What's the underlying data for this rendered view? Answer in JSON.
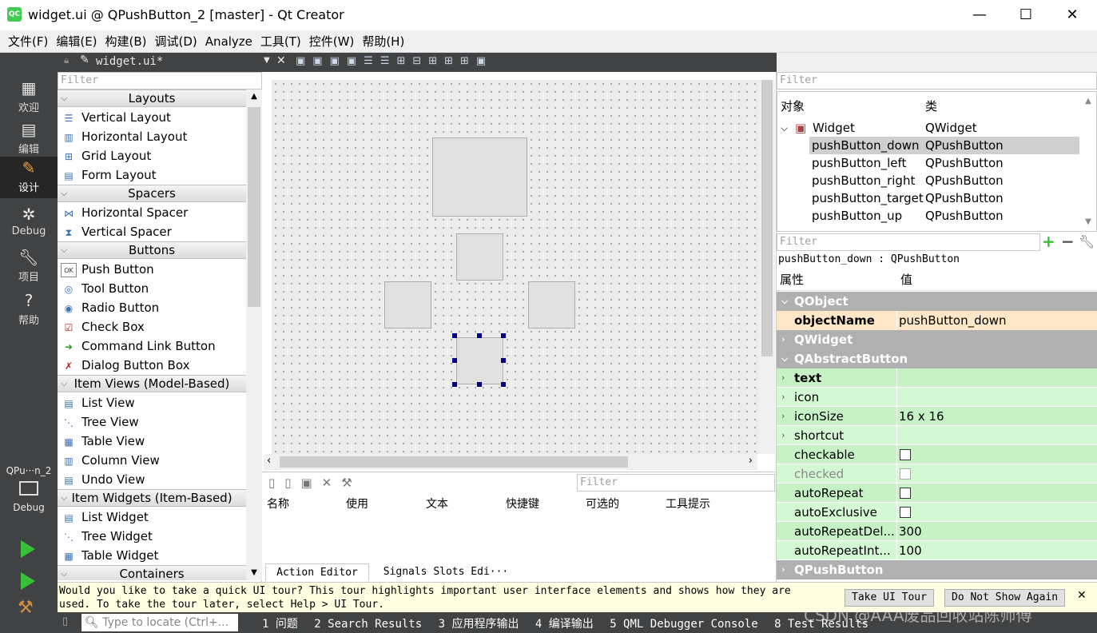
{
  "window": {
    "title": "widget.ui @ QPushButton_2 [master] - Qt Creator",
    "app_icon": "QC",
    "minimize": "—",
    "maximize": "☐",
    "close": "✕"
  },
  "menu": [
    "文件(F)",
    "编辑(E)",
    "构建(B)",
    "调试(D)",
    "Analyze",
    "工具(T)",
    "控件(W)",
    "帮助(H)"
  ],
  "modes": [
    {
      "icon": "grid-icon",
      "label": "欢迎"
    },
    {
      "icon": "edit-icon",
      "label": "编辑"
    },
    {
      "icon": "design-icon",
      "label": "设计"
    },
    {
      "icon": "bug-icon",
      "label": "Debug"
    },
    {
      "icon": "wrench-icon",
      "label": "项目"
    },
    {
      "icon": "help-icon",
      "label": "帮助"
    }
  ],
  "kit": {
    "name": "QPu···n_2",
    "mode": "Debug"
  },
  "doc_tab": {
    "name": "widget.ui*"
  },
  "left": {
    "filter_placeholder": "Filter",
    "categories": [
      {
        "name": "Layouts",
        "items": [
          "Vertical Layout",
          "Horizontal Layout",
          "Grid Layout",
          "Form Layout"
        ]
      },
      {
        "name": "Spacers",
        "items": [
          "Horizontal Spacer",
          "Vertical Spacer"
        ]
      },
      {
        "name": "Buttons",
        "items": [
          "Push Button",
          "Tool Button",
          "Radio Button",
          "Check Box",
          "Command Link Button",
          "Dialog Button Box"
        ]
      },
      {
        "name": "Item Views (Model-Based)",
        "items": [
          "List View",
          "Tree View",
          "Table View",
          "Column View",
          "Undo View"
        ]
      },
      {
        "name": "Item Widgets (Item-Based)",
        "items": [
          "List Widget",
          "Tree Widget",
          "Table Widget"
        ]
      },
      {
        "name": "Containers",
        "items": []
      }
    ]
  },
  "action_editor": {
    "filter_placeholder": "Filter",
    "columns": [
      "名称",
      "使用",
      "文本",
      "快捷键",
      "可选的",
      "工具提示"
    ],
    "tabs": [
      "Action Editor",
      "Signals  Slots Edi···"
    ]
  },
  "object_inspector": {
    "filter_placeholder": "Filter",
    "headers": [
      "对象",
      "类"
    ],
    "rows": [
      {
        "name": "Widget",
        "class": "QWidget"
      },
      {
        "name": "pushButton_down",
        "class": "QPushButton"
      },
      {
        "name": "pushButton_left",
        "class": "QPushButton"
      },
      {
        "name": "pushButton_right",
        "class": "QPushButton"
      },
      {
        "name": "pushButton_target",
        "class": "QPushButton"
      },
      {
        "name": "pushButton_up",
        "class": "QPushButton"
      }
    ]
  },
  "property_editor": {
    "filter_placeholder": "Filter",
    "selected": "pushButton_down : QPushButton",
    "headers": [
      "属性",
      "值"
    ],
    "rows": [
      {
        "kind": "group",
        "name": "QObject"
      },
      {
        "kind": "prop",
        "name": "objectName",
        "value": "pushButton_down",
        "bold": true
      },
      {
        "kind": "group",
        "name": "QWidget"
      },
      {
        "kind": "group",
        "name": "QAbstractButton"
      },
      {
        "kind": "prop",
        "name": "text",
        "value": "",
        "bold": true
      },
      {
        "kind": "prop",
        "name": "icon",
        "value": ""
      },
      {
        "kind": "prop",
        "name": "iconSize",
        "value": "16 x 16"
      },
      {
        "kind": "prop",
        "name": "shortcut",
        "value": ""
      },
      {
        "kind": "check",
        "name": "checkable"
      },
      {
        "kind": "check",
        "name": "checked"
      },
      {
        "kind": "check",
        "name": "autoRepeat"
      },
      {
        "kind": "check",
        "name": "autoExclusive"
      },
      {
        "kind": "prop",
        "name": "autoRepeatDel...",
        "value": "300"
      },
      {
        "kind": "prop",
        "name": "autoRepeatInt...",
        "value": "100"
      },
      {
        "kind": "group",
        "name": "QPushButton"
      }
    ]
  },
  "tour": {
    "line1": "Would you like to take a quick UI tour? This tour highlights important user interface elements and shows how they are",
    "line2": "used. To take the tour later, select Help > UI Tour.",
    "take": "Take UI Tour",
    "dismiss": "Do Not Show Again",
    "close": "✕"
  },
  "status": {
    "locate_placeholder": "Type to locate (Ctrl+...",
    "panes": [
      "1 问题",
      "2 Search Results",
      "3 应用程序输出",
      "4 编译输出",
      "5 QML Debugger Console",
      "8 Test Results"
    ],
    "watermark": "CSDN @AAA废品回收站陈师傅"
  }
}
